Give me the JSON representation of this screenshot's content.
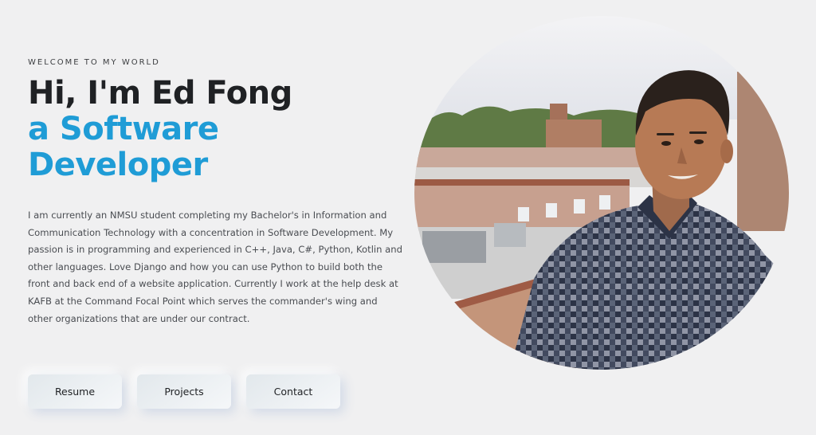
{
  "hero": {
    "welcome": "WELCOME TO MY WORLD",
    "greeting": "Hi, I'm Ed Fong",
    "role_line1": "a Software",
    "role_line2": "Developer",
    "bio": "I am currently an NMSU student completing my Bachelor's in Information and Communication Technology with a concentration in Software Development. My passion is in programming and experienced in C++, Java, C#, Python, Kotlin and other languages. Love Django and how you can use Python to build both the front and back end of a website application. Currently I work at the help desk at KAFB at the Command Focal Point which serves the commander's wing and other organizations that are under our contract."
  },
  "buttons": {
    "resume": "Resume",
    "projects": "Projects",
    "contact": "Contact"
  },
  "colors": {
    "accent": "#1f9cd6",
    "heading": "#1f2124",
    "background": "#f0f0f1"
  }
}
